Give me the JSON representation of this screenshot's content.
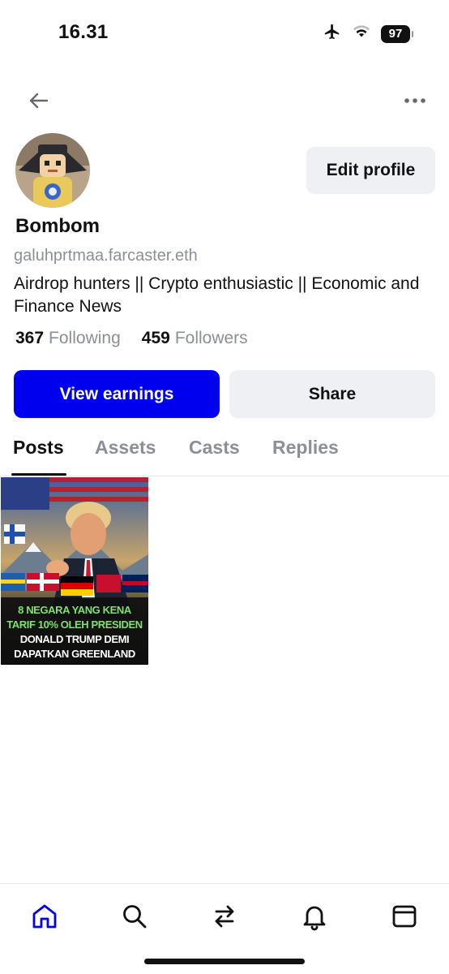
{
  "status_bar": {
    "time": "16.31",
    "battery": "97",
    "icons": [
      "airplane-icon",
      "wifi-icon",
      "battery-icon"
    ]
  },
  "header": {
    "back_icon": "arrow-left-icon",
    "more_icon": "more-horizontal-icon"
  },
  "profile": {
    "display_name": "Bombom",
    "username": "galuhprtmaa.farcaster.eth",
    "bio": "Airdrop hunters || Crypto enthusiastic || Economic and Finance News",
    "following_count": "367",
    "following_label": "Following",
    "followers_count": "459",
    "followers_label": "Followers",
    "edit_label": "Edit profile",
    "earnings_label": "View earnings",
    "share_label": "Share"
  },
  "tabs": [
    {
      "label": "Posts",
      "active": true
    },
    {
      "label": "Assets",
      "active": false
    },
    {
      "label": "Casts",
      "active": false
    },
    {
      "label": "Replies",
      "active": false
    }
  ],
  "posts": [
    {
      "caption_lines": [
        "8 NEGARA YANG KENA",
        "TARIF 10% OLEH PRESIDEN",
        "DONALD TRUMP DEMI",
        "DAPATKAN GREENLAND"
      ]
    }
  ],
  "bottom_nav": [
    "home-icon",
    "search-icon",
    "swap-icon",
    "bell-icon",
    "wallet-icon"
  ],
  "colors": {
    "accent": "#0000ee",
    "muted_text": "#8a8f98",
    "button_bg": "#eef0f4"
  }
}
